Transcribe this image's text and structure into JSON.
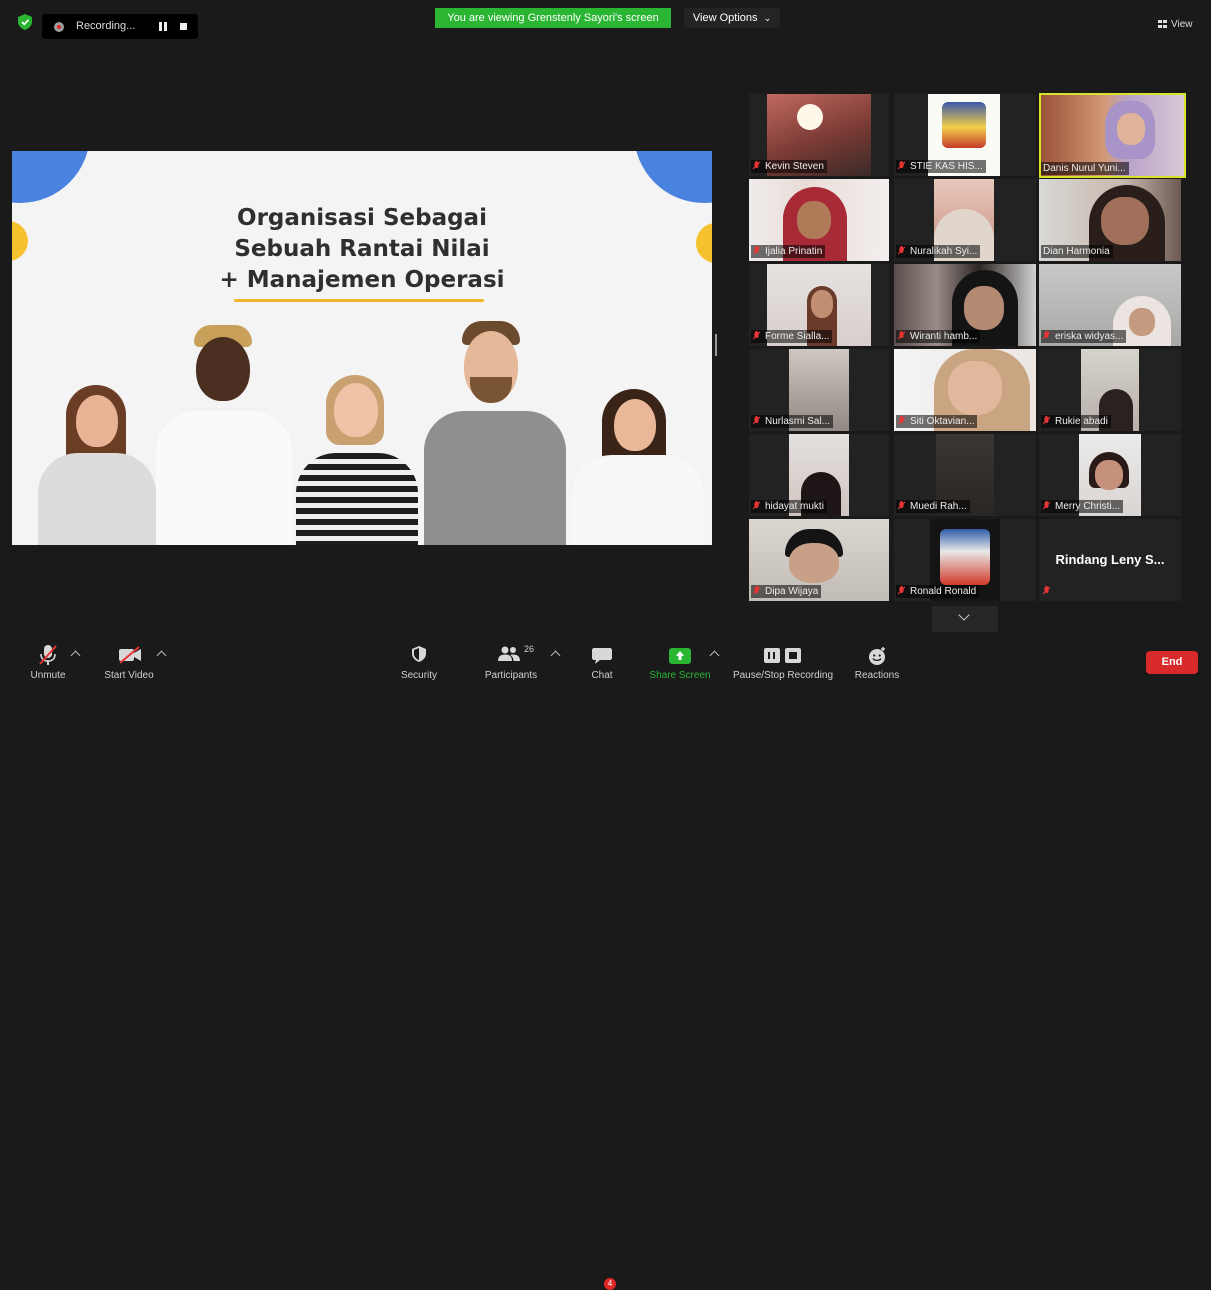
{
  "topbar": {
    "recording_label": "Recording...",
    "viewing_banner": "You are viewing Grenstenly Sayori's screen",
    "view_options_label": "View Options",
    "view_label": "View"
  },
  "slide": {
    "title_lines": [
      "Organisasi Sebagai",
      "Sebuah Rantai Nilai",
      "+ Manajemen Operasi"
    ],
    "accent_color": "#f2b42a",
    "blob_blue": "#4a82e0",
    "blob_yellow": "#f6c12f"
  },
  "gallery": {
    "participants": [
      {
        "name": "Kevin Steven",
        "active": false
      },
      {
        "name": "STIE KAS HIS...",
        "active": false
      },
      {
        "name": "Danis Nurul Yuni...",
        "active": true
      },
      {
        "name": "Ijalia Prinatin",
        "active": false
      },
      {
        "name": "Nuralikah Syi...",
        "active": false
      },
      {
        "name": "Dian Harmonia",
        "active": false
      },
      {
        "name": "Forme Sialla...",
        "active": false
      },
      {
        "name": "Wiranti hamb...",
        "active": false
      },
      {
        "name": "eriska widyas...",
        "active": false
      },
      {
        "name": "Nurlasmi Sal...",
        "active": false
      },
      {
        "name": "Siti Oktavian...",
        "active": false
      },
      {
        "name": "Rukie abadi",
        "active": false
      },
      {
        "name": "hidayat mukti",
        "active": false
      },
      {
        "name": "Muedi Rah...",
        "active": false
      },
      {
        "name": "Merry Christi...",
        "active": false
      },
      {
        "name": "Dipa Wijaya",
        "active": false
      },
      {
        "name": "Ronald Ronald",
        "active": false
      },
      {
        "name": "",
        "display_name": "Rindang Leny S...",
        "active": false
      }
    ],
    "active_border_color": "#d7e22a"
  },
  "toolbar": {
    "unmute": "Unmute",
    "start_video": "Start Video",
    "security": "Security",
    "participants": "Participants",
    "participants_count": "26",
    "chat": "Chat",
    "chat_badge": "4",
    "share_screen": "Share Screen",
    "pause_stop_recording": "Pause/Stop Recording",
    "reactions": "Reactions",
    "end": "End",
    "share_color": "#2ab533",
    "end_color": "#d82a2a"
  }
}
